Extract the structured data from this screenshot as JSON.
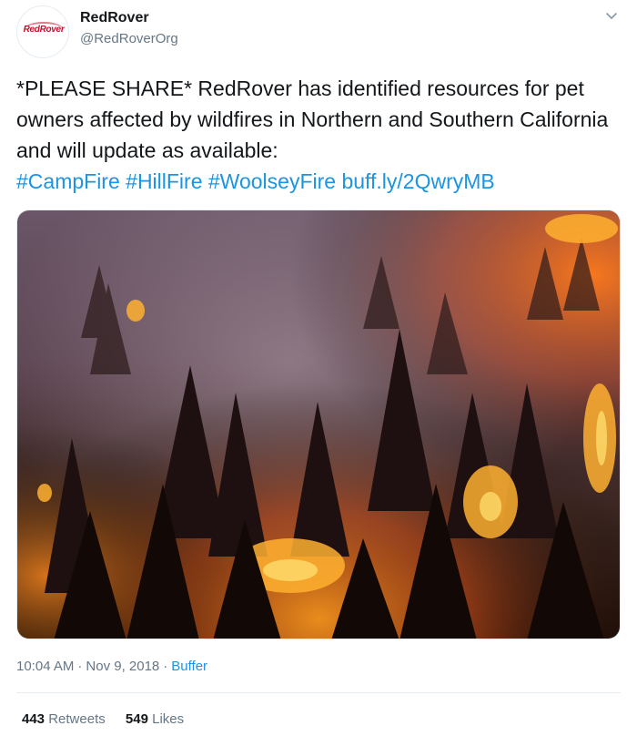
{
  "tweet": {
    "avatar_logo_text": "RedRover",
    "display_name": "RedRover",
    "handle": "@RedRoverOrg",
    "menu_icon": "chevron-down-icon",
    "text": {
      "part1": "*PLEASE SHARE* RedRover has identified resources for pet owners affected by wildfires in Northern and Southern California and will update as available:",
      "hashtag1": "#CampFire",
      "hashtag2": "#HillFire",
      "hashtag3": "#WoolseyFire",
      "link": "buff.ly/2QwryMB"
    },
    "time": "10:04 AM",
    "date": "Nov 9, 2018",
    "separator": "·",
    "source": "Buffer",
    "retweets_count": "443",
    "retweets_label": "Retweets",
    "likes_count": "549",
    "likes_label": "Likes"
  },
  "colors": {
    "link": "#1b95e0",
    "text": "#14171a",
    "secondary": "#657786",
    "brand": "#c8102e"
  }
}
